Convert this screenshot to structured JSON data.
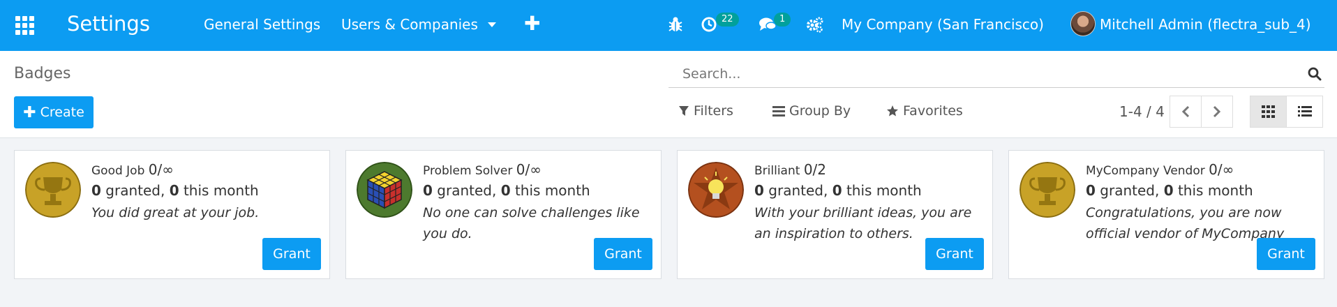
{
  "navbar": {
    "app_name": "Settings",
    "menu": [
      "General Settings",
      "Users & Companies"
    ],
    "activity_count": "22",
    "message_count": "1",
    "company": "My Company (San Francisco)",
    "user": "Mitchell Admin (flectra_sub_4)"
  },
  "control": {
    "breadcrumb": "Badges",
    "create_label": "Create",
    "search_placeholder": "Search...",
    "filters_label": "Filters",
    "groupby_label": "Group By",
    "favorites_label": "Favorites",
    "pager": "1-4 / 4"
  },
  "cards": [
    {
      "name": "Good Job",
      "count": "0/∞",
      "granted": "0",
      "granted_label": " granted, ",
      "month": "0",
      "month_label": " this month",
      "description": "You did great at your job.",
      "grant_label": "Grant",
      "icon": "trophy-medal"
    },
    {
      "name": "Problem Solver",
      "count": "0/∞",
      "granted": "0",
      "granted_label": " granted, ",
      "month": "0",
      "month_label": " this month",
      "description": "No one can solve challenges like you do.",
      "grant_label": "Grant",
      "icon": "rubik-cube-medal"
    },
    {
      "name": "Brilliant",
      "count": "0/2",
      "granted": "0",
      "granted_label": " granted, ",
      "month": "0",
      "month_label": " this month",
      "description": "With your brilliant ideas, you are an inspiration to others.",
      "grant_label": "Grant",
      "icon": "lightbulb-star-medal"
    },
    {
      "name": "MyCompany Vendor",
      "count": "0/∞",
      "granted": "0",
      "granted_label": " granted, ",
      "month": "0",
      "month_label": " this month",
      "description": "Congratulations, you are now official vendor of MyCompany",
      "grant_label": "Grant",
      "icon": "trophy-medal"
    }
  ],
  "colors": {
    "primary": "#0c9cf2",
    "badge": "#01a09c",
    "background": "#f2f4f7"
  }
}
